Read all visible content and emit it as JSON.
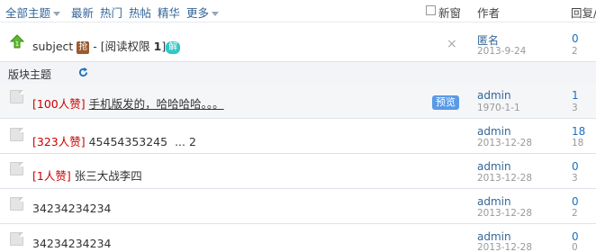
{
  "filters": {
    "all": "全部主题",
    "latest": "最新",
    "hot": "热门",
    "hot_posts": "热帖",
    "digest": "精华",
    "more": "更多",
    "new_window": "新窗"
  },
  "columns": {
    "author": "作者",
    "replies": "回复/"
  },
  "pinned": {
    "title": "subject",
    "grab_badge": "抢",
    "separator": " - ",
    "perm": "[阅读权限 ",
    "perm_level": "1",
    "perm_end": "]",
    "solved_badge": "解",
    "author": "匿名",
    "date": "2013-9-24",
    "replies": "0",
    "views": "2"
  },
  "section": {
    "title": "版块主题"
  },
  "threads": [
    {
      "zan": "[100人赞]",
      "title": "手机版发的，哈哈哈哈。。。",
      "preview": "预览",
      "author": "admin",
      "date": "1970-1-1",
      "replies": "1",
      "views": "3"
    },
    {
      "zan": "[323人赞]",
      "title": "45454353245",
      "pages": "... 2",
      "author": "admin",
      "date": "2013-12-28",
      "replies": "18",
      "views": "18"
    },
    {
      "zan": "[1人赞]",
      "title": "张三大战李四",
      "author": "admin",
      "date": "2013-12-28",
      "replies": "0",
      "views": "3"
    },
    {
      "title": "34234234234",
      "author": "admin",
      "date": "2013-12-28",
      "replies": "0",
      "views": "2"
    },
    {
      "title": "34234234234",
      "author": "admin",
      "date": "2013-12-28",
      "replies": "0",
      "views": "0"
    }
  ],
  "colors": {
    "link": "#336699",
    "count": "#1a6fc2",
    "zan": "#cc0000",
    "preview": "#5a9ae6"
  }
}
